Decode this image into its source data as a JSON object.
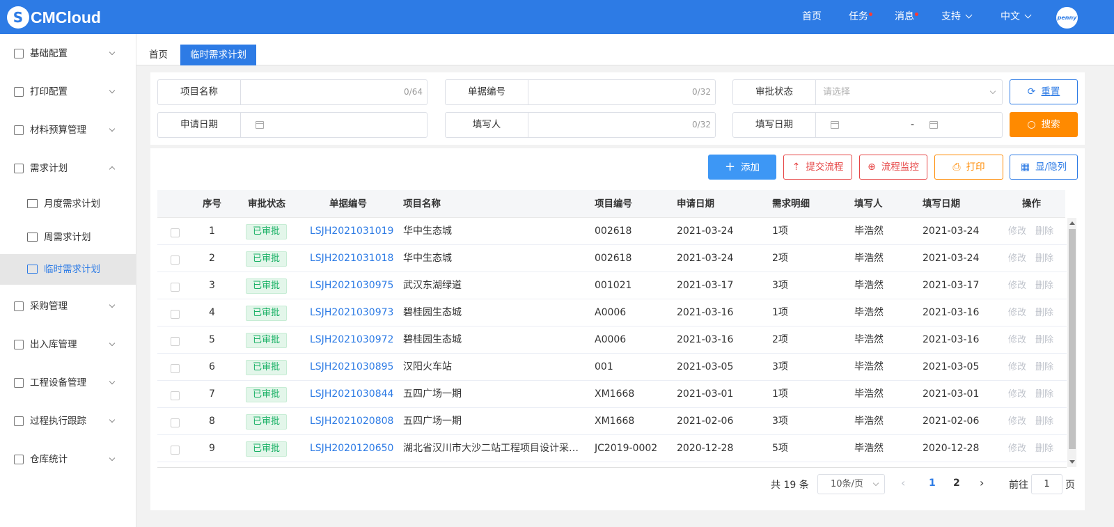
{
  "header": {
    "logo_text": "CMCloud",
    "nav": [
      {
        "label": "首页",
        "dot": false
      },
      {
        "label": "任务",
        "dot": true
      },
      {
        "label": "消息",
        "dot": true
      },
      {
        "label": "支持",
        "dot": false
      },
      {
        "label": "中文",
        "dot": false
      }
    ],
    "avatar_text": "penny"
  },
  "sidebar": {
    "items": [
      {
        "label": "基础配置",
        "icon": "grid-icon"
      },
      {
        "label": "打印配置",
        "icon": "layers-icon"
      },
      {
        "label": "材料预算管理",
        "icon": "database-icon"
      },
      {
        "label": "需求计划",
        "icon": "document-icon",
        "expanded": true
      },
      {
        "label": "采购管理",
        "icon": "org-chart-icon"
      },
      {
        "label": "出入库管理",
        "icon": "warehouse-icon"
      },
      {
        "label": "工程设备管理",
        "icon": "cube-icon"
      },
      {
        "label": "过程执行跟踪",
        "icon": "chart-icon"
      },
      {
        "label": "仓库统计",
        "icon": "database-icon"
      }
    ],
    "subitems": [
      {
        "label": "月度需求计划",
        "icon": "report-icon"
      },
      {
        "label": "周需求计划",
        "icon": "calendar-icon"
      },
      {
        "label": "临时需求计划",
        "icon": "id-card-icon",
        "active": true
      }
    ]
  },
  "tabs": [
    {
      "label": "首页"
    },
    {
      "label": "临时需求计划",
      "active": true
    }
  ],
  "search": {
    "project_name": {
      "label": "项目名称",
      "count": "0/64"
    },
    "doc_no": {
      "label": "单据编号",
      "count": "0/32"
    },
    "status": {
      "label": "审批状态",
      "placeholder": "请选择"
    },
    "apply_date": {
      "label": "申请日期"
    },
    "filler": {
      "label": "填写人",
      "count": "0/32"
    },
    "fill_date": {
      "label": "填写日期",
      "separator": "-"
    },
    "reset_label": "重置",
    "search_label": "搜索"
  },
  "toolbar": {
    "add": "添加",
    "submit_flow": "提交流程",
    "monitor_flow": "流程监控",
    "print": "打印",
    "toggle_cols": "显/隐列"
  },
  "table": {
    "columns": [
      "序号",
      "审批状态",
      "单据编号",
      "项目名称",
      "项目编号",
      "申请日期",
      "需求明细",
      "填写人",
      "填写日期",
      "操作"
    ],
    "edit_label": "修改",
    "delete_label": "删除",
    "rows": [
      {
        "no": "1",
        "status": "已审批",
        "doc": "LSJH2021031019",
        "project": "华中生态城",
        "code": "002618",
        "apply": "2021-03-24",
        "detail": "1项",
        "filler": "毕浩然",
        "fill": "2021-03-24"
      },
      {
        "no": "2",
        "status": "已审批",
        "doc": "LSJH2021031018",
        "project": "华中生态城",
        "code": "002618",
        "apply": "2021-03-24",
        "detail": "2项",
        "filler": "毕浩然",
        "fill": "2021-03-24"
      },
      {
        "no": "3",
        "status": "已审批",
        "doc": "LSJH2021030975",
        "project": "武汉东湖绿道",
        "code": "001021",
        "apply": "2021-03-17",
        "detail": "3项",
        "filler": "毕浩然",
        "fill": "2021-03-17"
      },
      {
        "no": "4",
        "status": "已审批",
        "doc": "LSJH2021030973",
        "project": "碧桂园生态城",
        "code": "A0006",
        "apply": "2021-03-16",
        "detail": "1项",
        "filler": "毕浩然",
        "fill": "2021-03-16"
      },
      {
        "no": "5",
        "status": "已审批",
        "doc": "LSJH2021030972",
        "project": "碧桂园生态城",
        "code": "A0006",
        "apply": "2021-03-16",
        "detail": "2项",
        "filler": "毕浩然",
        "fill": "2021-03-16"
      },
      {
        "no": "6",
        "status": "已审批",
        "doc": "LSJH2021030895",
        "project": "汉阳火车站",
        "code": "001",
        "apply": "2021-03-05",
        "detail": "3项",
        "filler": "毕浩然",
        "fill": "2021-03-05"
      },
      {
        "no": "7",
        "status": "已审批",
        "doc": "LSJH2021030844",
        "project": "五四广场一期",
        "code": "XM1668",
        "apply": "2021-03-01",
        "detail": "1项",
        "filler": "毕浩然",
        "fill": "2021-03-01"
      },
      {
        "no": "8",
        "status": "已审批",
        "doc": "LSJH2021020808",
        "project": "五四广场一期",
        "code": "XM1668",
        "apply": "2021-02-06",
        "detail": "3项",
        "filler": "毕浩然",
        "fill": "2021-02-06"
      },
      {
        "no": "9",
        "status": "已审批",
        "doc": "LSJH2020120650",
        "project": "湖北省汉川市大沙二站工程项目设计采…",
        "code": "JC2019-0002",
        "apply": "2020-12-28",
        "detail": "5项",
        "filler": "毕浩然",
        "fill": "2020-12-28"
      }
    ]
  },
  "pagination": {
    "total": "共 19 条",
    "page_size": "10条/页",
    "pages": [
      "1",
      "2"
    ],
    "current": "1",
    "goto_prefix": "前往",
    "goto_value": "1",
    "goto_suffix": "页"
  },
  "colors": {
    "primary": "#2d7be5",
    "orange": "#ff8a00",
    "danger": "#e64545",
    "success_text": "#17b064"
  }
}
